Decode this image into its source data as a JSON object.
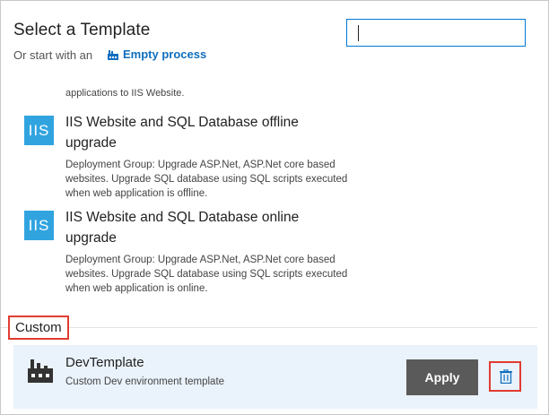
{
  "header": {
    "title": "Select a Template",
    "subtitle": "Or start with an",
    "empty_process_label": "Empty process"
  },
  "search": {
    "value": "",
    "placeholder": ""
  },
  "partial_item": {
    "text": "applications to IIS Website."
  },
  "templates": [
    {
      "icon_text": "IIS",
      "name": "IIS Website and SQL Database offline upgrade",
      "description": "Deployment Group: Upgrade ASP.Net, ASP.Net core based websites. Upgrade SQL database using SQL scripts executed when web application is offline."
    },
    {
      "icon_text": "IIS",
      "name": "IIS Website and SQL Database online upgrade",
      "description": "Deployment Group: Upgrade ASP.Net, ASP.Net core based websites. Upgrade SQL database using SQL scripts executed when web application is online."
    }
  ],
  "custom_section": {
    "label": "Custom",
    "items": [
      {
        "name": "DevTemplate",
        "description": "Custom Dev environment template",
        "apply_label": "Apply",
        "icon": "factory-icon",
        "delete_icon": "trash-icon"
      }
    ]
  },
  "colors": {
    "accent": "#106ebe",
    "iis_tile": "#31a4e0",
    "highlight_box": "#e03c31",
    "selected_row": "#eaf2fb",
    "apply_button": "#5a5a5a"
  }
}
